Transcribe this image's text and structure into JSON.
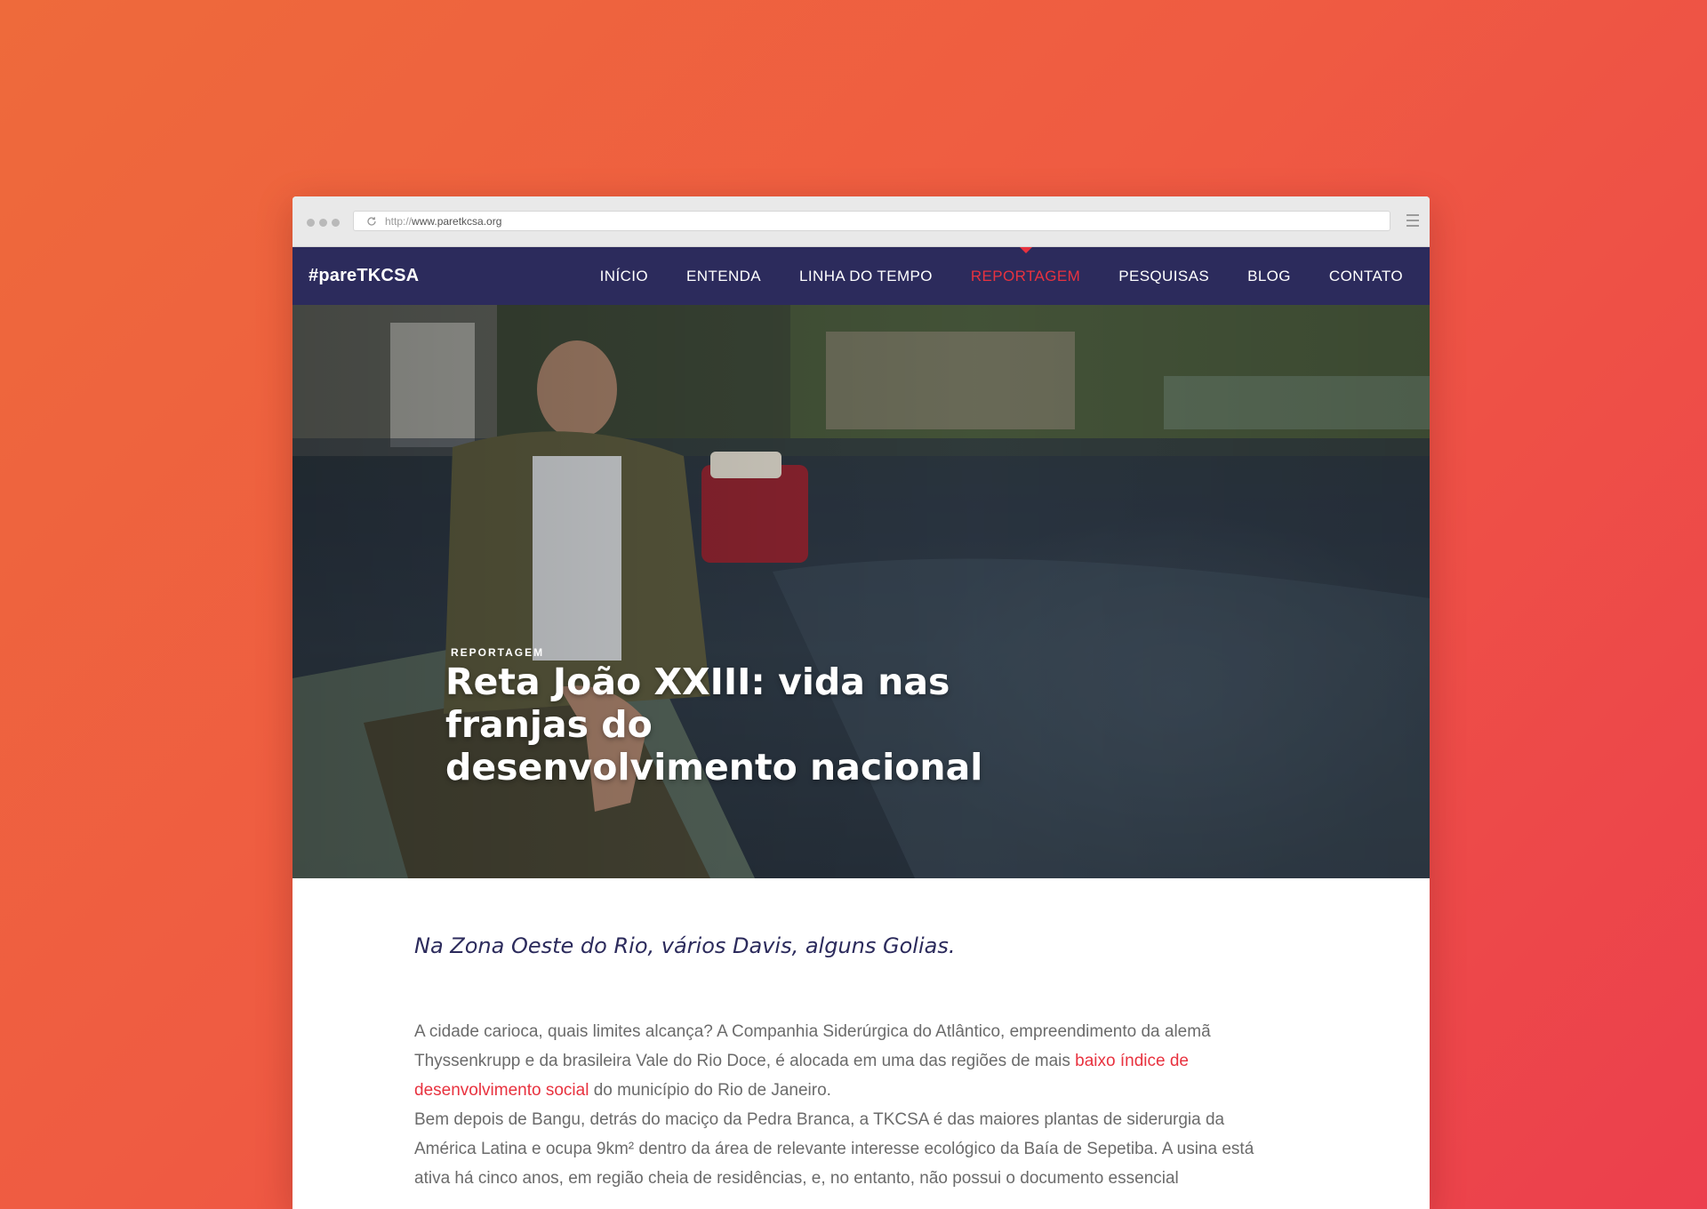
{
  "browser": {
    "url_prefix": "http://",
    "url_host": "www.paretkcsa.org"
  },
  "site": {
    "logo": "#pareTKCSA",
    "nav": [
      {
        "label": "INÍCIO",
        "active": false
      },
      {
        "label": "ENTENDA",
        "active": false
      },
      {
        "label": "LINHA DO TEMPO",
        "active": false
      },
      {
        "label": "REPORTAGEM",
        "active": true
      },
      {
        "label": "PESQUISAS",
        "active": false
      },
      {
        "label": "BLOG",
        "active": false
      },
      {
        "label": "CONTATO",
        "active": false
      }
    ]
  },
  "hero": {
    "kicker": "REPORTAGEM",
    "title": "Reta João XXIII: vida nas franjas do desenvolvimento nacional"
  },
  "article": {
    "subtitle": "Na Zona Oeste do Rio, vários Davis, alguns Golias.",
    "p1_a": "A cidade carioca, quais limites alcança? A Companhia Siderúrgica do Atlântico, empreendimento da alemã Thyssenkrupp e da brasileira Vale do Rio Doce, é alocada em uma das regiões de mais ",
    "p1_link": "baixo índice de desenvolvimento social",
    "p1_b": " do município do Rio de Janeiro.",
    "p2": "Bem depois de Bangu, detrás do maciço da Pedra Branca, a TKCSA é das maiores plantas de siderurgia da América Latina e ocupa 9km² dentro da área de relevante interesse ecológico da Baía de Sepetiba. A usina está ativa há cinco anos, em região cheia de residências, e, no entanto, não possui o documento essencial"
  },
  "colors": {
    "nav_bg": "#2c2b5c",
    "accent": "#e8323f",
    "text": "#6b6b6b"
  }
}
